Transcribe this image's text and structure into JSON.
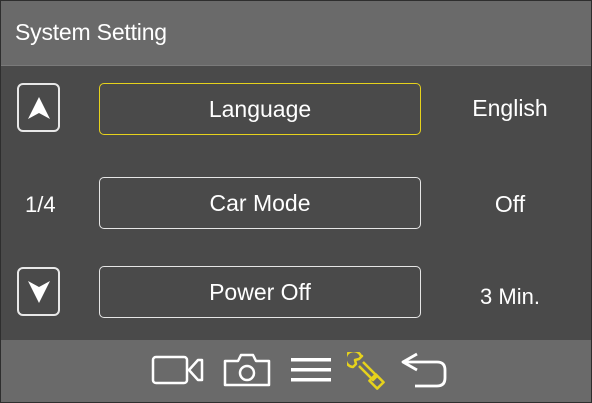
{
  "header": {
    "title": "System Setting"
  },
  "nav": {
    "page_indicator": "1/4",
    "up_icon": "arrow-up-icon",
    "down_icon": "arrow-down-icon"
  },
  "menu": {
    "items": [
      {
        "label": "Language",
        "value": "English",
        "selected": true
      },
      {
        "label": "Car Mode",
        "value": "Off",
        "selected": false
      },
      {
        "label": "Power Off",
        "value": "3 Min.",
        "selected": false
      }
    ]
  },
  "footer": {
    "icons": [
      "video-camera-icon",
      "camera-icon",
      "menu-icon",
      "wrench-icon",
      "return-icon"
    ],
    "active_icon": "wrench-icon"
  },
  "colors": {
    "background": "#4a4a4a",
    "bar": "#6a6a6a",
    "highlight": "#e6d21c",
    "text": "#ffffff"
  }
}
